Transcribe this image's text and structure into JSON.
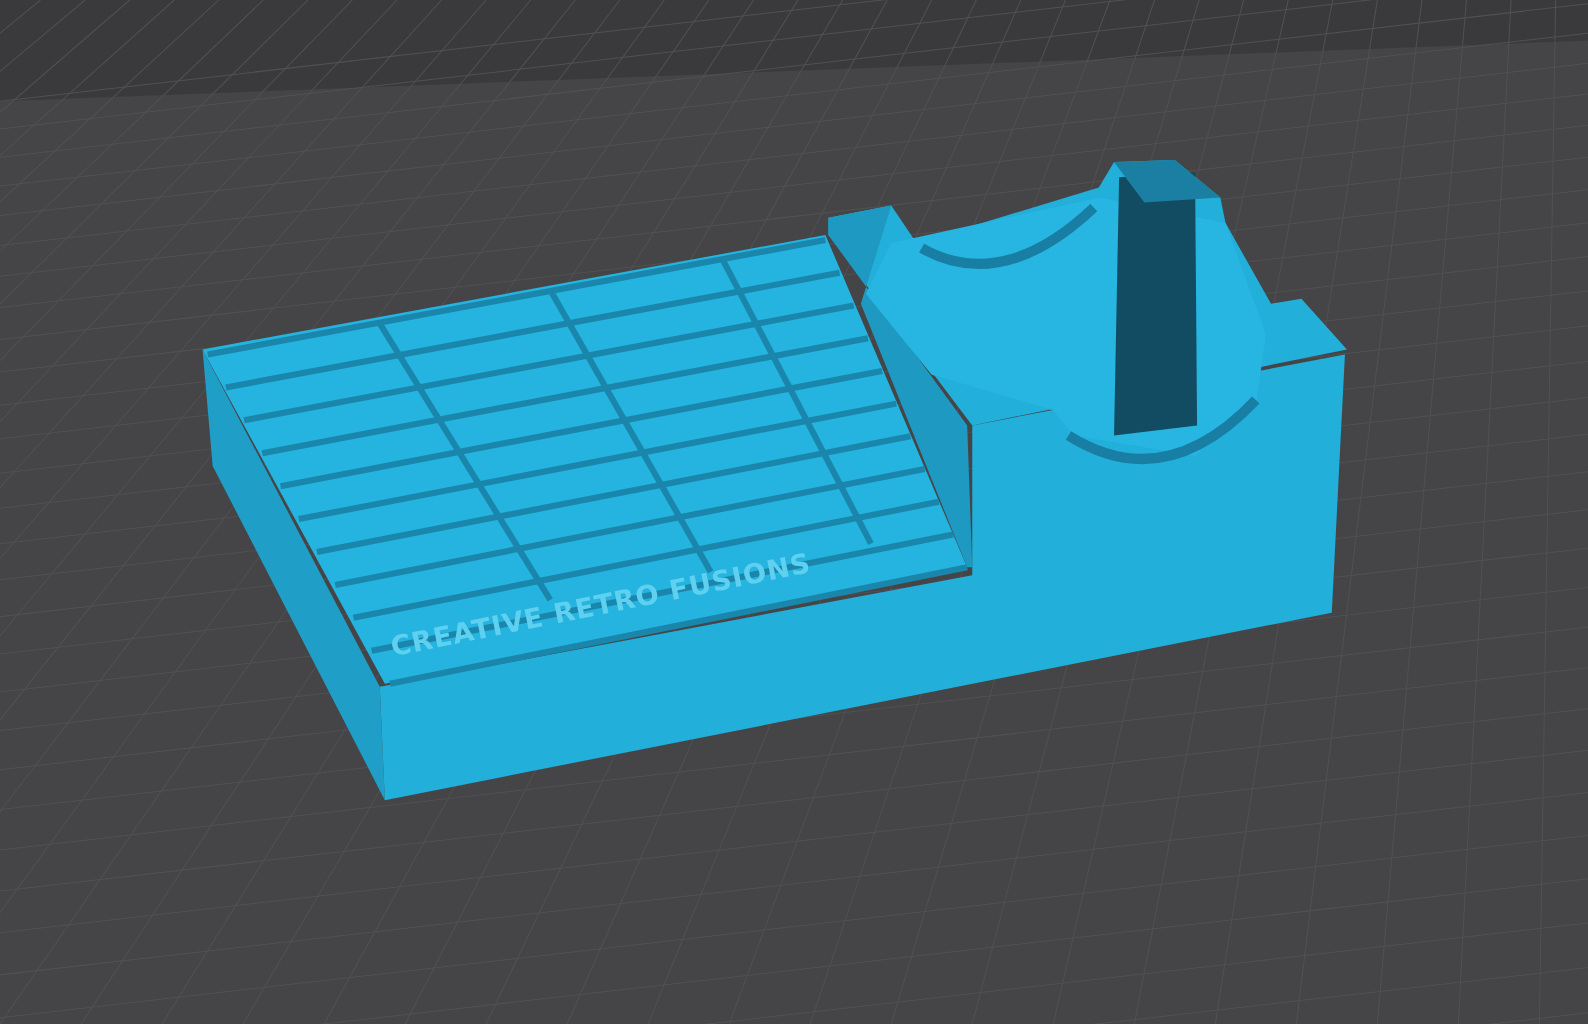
{
  "viewport": {
    "model_label": "CREATIVE RETRO FUSIONS"
  }
}
